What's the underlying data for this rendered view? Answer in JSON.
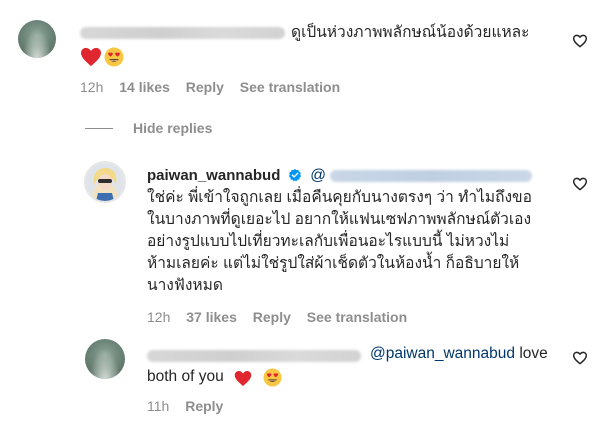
{
  "comment1": {
    "text": "ดูเป็นห่วงภาพพลักษณ์น้องด้วยแหละ",
    "meta": {
      "time": "12h",
      "likes": "14 likes",
      "reply": "Reply",
      "translate": "See translation"
    }
  },
  "hide_replies": {
    "label": "Hide replies"
  },
  "reply1": {
    "username": "paiwan_wannabud",
    "mention": "@",
    "lines": [
      "ใช่ค่ะ พี่เข้าใจถูกเลย เมื่อคืนคุยกับนางตรงๆ ว่า ทำไมถึงขอ",
      "ในบางภาพที่ดูเยอะไป อยากให้แฟนเซฟภาพพลักษณ์ตัวเอง",
      "อย่างรูปแบบไปเที่ยวทะเลกับเพื่อนอะไรแบบนี้ ไม่หวงไม่",
      "ห้ามเลยค่ะ แต่ไม่ใช่รูปใส่ผ้าเช็ดตัวในห้องน้ำ ก็อธิบายให้",
      "นางฟังหมด"
    ],
    "meta": {
      "time": "12h",
      "likes": "37 likes",
      "reply": "Reply",
      "translate": "See translation"
    }
  },
  "reply2": {
    "mention": "@paiwan_wannabud",
    "text_end": " love",
    "line2": "both of you",
    "meta": {
      "time": "11h",
      "reply": "Reply"
    }
  },
  "colors": {
    "text": "#262626",
    "meta": "#8e8e8e",
    "mention": "#00376b",
    "verified": "#0095f6",
    "heart": "#ed4956"
  }
}
